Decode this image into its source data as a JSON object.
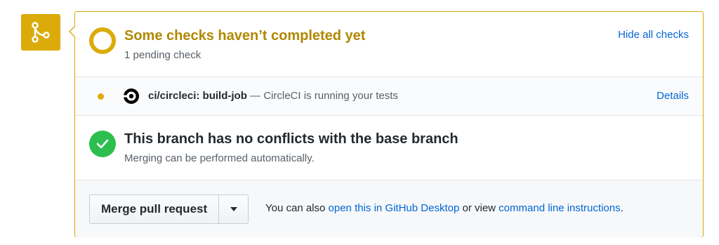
{
  "status": {
    "title": "Some checks haven’t completed yet",
    "subtitle": "1 pending check",
    "hide_link": "Hide all checks"
  },
  "check": {
    "name": "ci/circleci: build-job",
    "separator": " — ",
    "description": "CircleCI is running your tests",
    "details_link": "Details"
  },
  "conflicts": {
    "title": "This branch has no conflicts with the base branch",
    "subtitle": "Merging can be performed automatically."
  },
  "merge": {
    "button_label": "Merge pull request",
    "hint_prefix": "You can also ",
    "desktop_link": "open this in GitHub Desktop",
    "hint_middle": " or view ",
    "cli_link": "command line instructions",
    "hint_suffix": "."
  },
  "colors": {
    "pending": "#dbab09",
    "pending_text": "#b08800",
    "success": "#2cbe4e",
    "link": "#0366d6"
  },
  "icons": {
    "merge": "git-merge-icon",
    "pending": "pending-ring-icon",
    "dot": "pending-dot-icon",
    "circleci": "circleci-logo-icon",
    "success": "check-circle-icon",
    "dropdown": "triangle-down-icon"
  }
}
